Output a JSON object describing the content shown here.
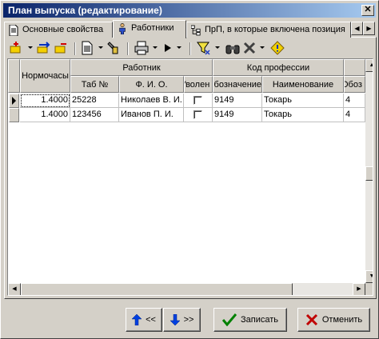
{
  "window": {
    "title": "План выпуска (редактирование)"
  },
  "tabs": [
    {
      "label": "Основные свойства",
      "active": false
    },
    {
      "label": "Работники",
      "active": true
    },
    {
      "label": "ПрП, в которые включена позиция",
      "active": false
    }
  ],
  "toolbar": {
    "icons": [
      "add-icon",
      "move-icon",
      "delete-icon",
      "document-icon",
      "tool-icon",
      "print-icon",
      "run-icon",
      "filter-icon",
      "binoculars-icon",
      "tools-icon",
      "info-icon"
    ]
  },
  "grid": {
    "group_headers": {
      "worker": "Работник",
      "profession_code": "Код профессии"
    },
    "columns": {
      "hours": "Нормочасы",
      "tab_no": "Таб №",
      "fio": "Ф. И. О.",
      "fired": "Уволен",
      "designation": "Обозначение",
      "name": "Наименование",
      "extra": "Обоз"
    },
    "rows": [
      {
        "hours": "1.4000",
        "tab_no": "25228",
        "fio": "Николаев В. И.",
        "fired": false,
        "designation": "9149",
        "name": "Токарь",
        "extra": "4",
        "current": true
      },
      {
        "hours": "1.4000",
        "tab_no": "123456",
        "fio": "Иванов П. И.",
        "fired": false,
        "designation": "9149",
        "name": "Токарь",
        "extra": "4",
        "current": false
      }
    ]
  },
  "buttons": {
    "up": "<<",
    "down": ">>",
    "save": "Записать",
    "cancel": "Отменить"
  }
}
